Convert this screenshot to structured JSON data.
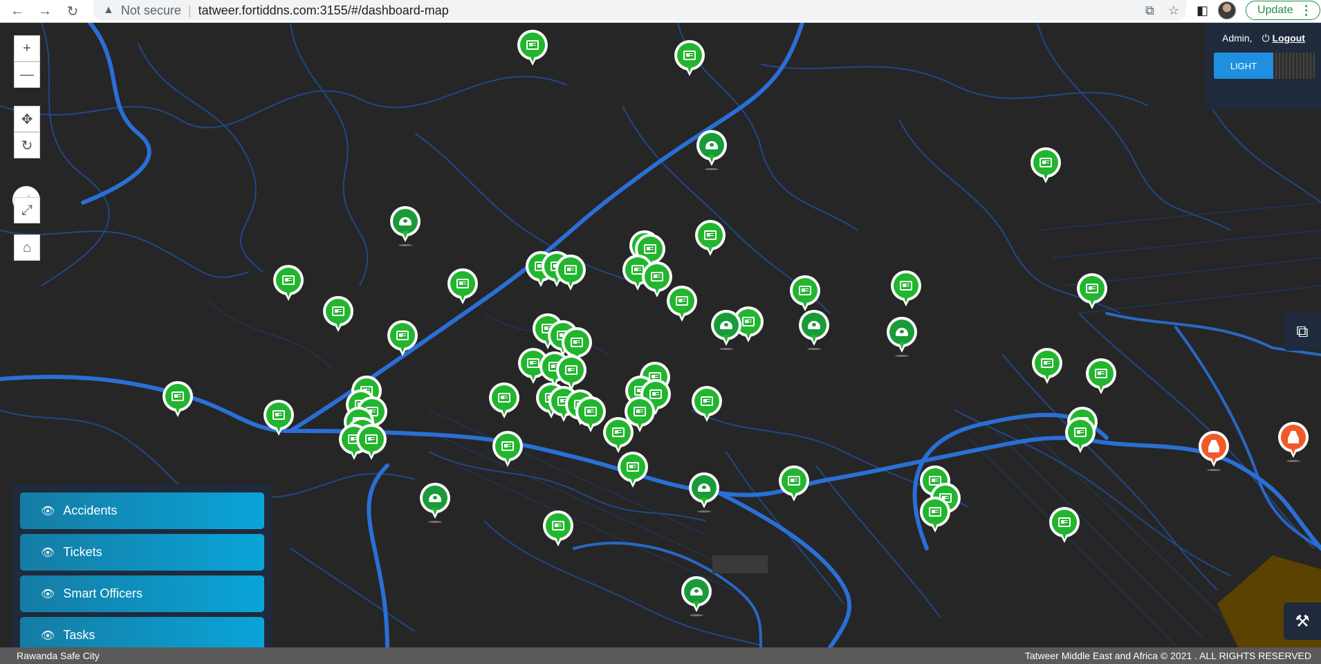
{
  "browser": {
    "security_label": "Not secure",
    "url": "tatweer.fortiddns.com:3155/#/dashboard-map",
    "update_label": "Update"
  },
  "admin": {
    "user_label": "Admin,",
    "logout_label": "Logout",
    "theme_label": "LIGHT"
  },
  "layers": [
    {
      "label": "Accidents"
    },
    {
      "label": "Tickets"
    },
    {
      "label": "Smart Officers"
    },
    {
      "label": "Tasks"
    }
  ],
  "footer": {
    "left": "Rawanda Safe City",
    "right": "Tatweer Middle East and Africa © 2021 . ALL RIGHTS RESERVED"
  },
  "colors": {
    "map_bg": "#262626",
    "road": "#2a6fd6",
    "pin_green": "#22b52e",
    "pin_red": "#f05a28",
    "panel": "#1f2a3d",
    "layer_btn": "#0aa4d8"
  },
  "markers": {
    "tickets": 63,
    "officers": 9,
    "accidents": 2
  }
}
